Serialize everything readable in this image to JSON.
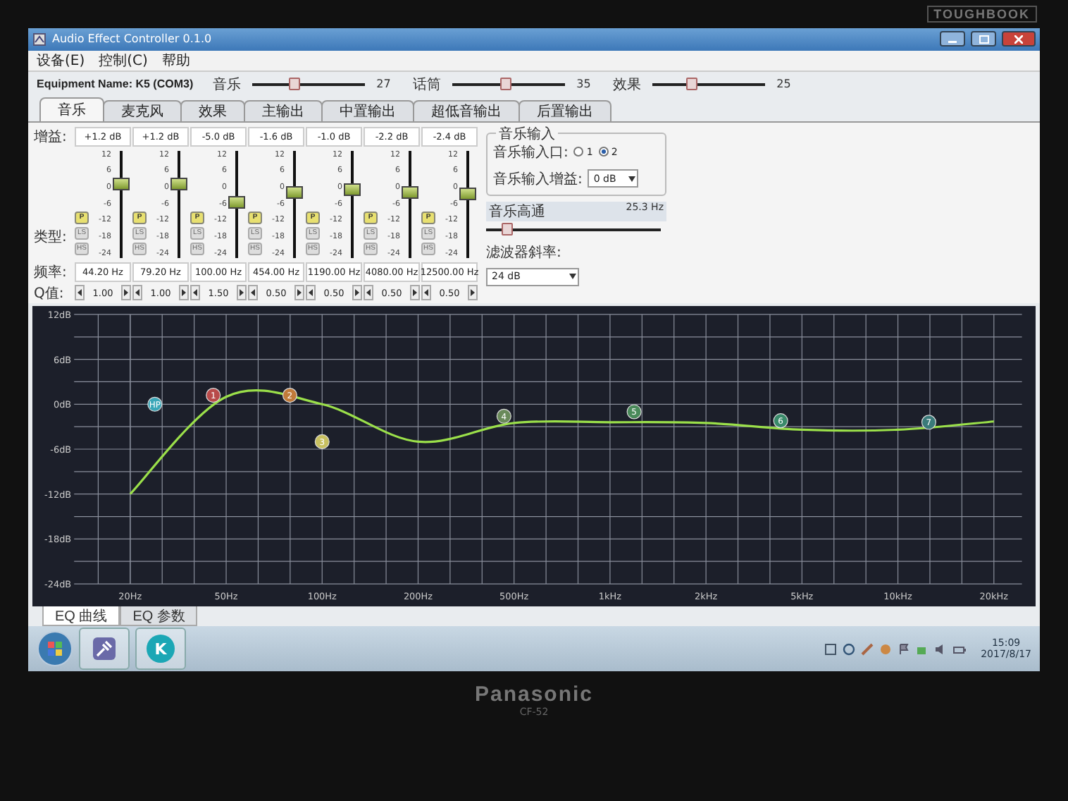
{
  "bezel": {
    "badge": "TOUGHBOOK",
    "brand": "Panasonic",
    "model": "CF-52"
  },
  "window": {
    "title": "Audio Effect Controller 0.1.0"
  },
  "menu": [
    {
      "label": "设备(E)"
    },
    {
      "label": "控制(C)"
    },
    {
      "label": "帮助"
    }
  ],
  "equipment": {
    "label": "Equipment Name: K5 (COM3)"
  },
  "volumes": [
    {
      "label": "音乐",
      "value": "27",
      "level": 0.37
    },
    {
      "label": "话筒",
      "value": "35",
      "level": 0.47
    },
    {
      "label": "效果",
      "value": "25",
      "level": 0.35
    }
  ],
  "tabs": [
    {
      "label": "音乐",
      "selected": true
    },
    {
      "label": "麦克风",
      "selected": false
    },
    {
      "label": "效果",
      "selected": false
    },
    {
      "label": "主输出",
      "selected": false
    },
    {
      "label": "中置输出",
      "selected": false
    },
    {
      "label": "超低音输出",
      "selected": false
    },
    {
      "label": "后置输出",
      "selected": false
    }
  ],
  "eq": {
    "row_labels": {
      "gain": "增益:",
      "type": "类型:",
      "freq": "频率:",
      "q": "Q值:"
    },
    "bands": [
      {
        "gain": "+1.2 dB",
        "level": 0.7,
        "scale": [
          "12",
          "6",
          "0",
          "-6",
          "-12",
          "-18",
          "-24"
        ],
        "types": [
          {
            "label": "P",
            "selected": true
          },
          {
            "label": "LS",
            "selected": false
          },
          {
            "label": "HS",
            "selected": false
          }
        ],
        "freq": "44.20 Hz",
        "q": "1.00"
      },
      {
        "gain": "+1.2 dB",
        "level": 0.7,
        "scale": [
          "12",
          "6",
          "0",
          "-6",
          "-12",
          "-18",
          "-24"
        ],
        "types": [
          {
            "label": "P",
            "selected": true
          },
          {
            "label": "LS",
            "selected": false
          },
          {
            "label": "HS",
            "selected": false
          }
        ],
        "freq": "79.20 Hz",
        "q": "1.00"
      },
      {
        "gain": "-5.0 dB",
        "level": 0.53,
        "scale": [
          "12",
          "6",
          "0",
          "-6",
          "-12",
          "-18",
          "-24"
        ],
        "types": [
          {
            "label": "P",
            "selected": true
          },
          {
            "label": "LS",
            "selected": false
          },
          {
            "label": "HS",
            "selected": false
          }
        ],
        "freq": "100.00 Hz",
        "q": "1.50"
      },
      {
        "gain": "-1.6 dB",
        "level": 0.62,
        "scale": [
          "12",
          "6",
          "0",
          "-6",
          "-12",
          "-18",
          "-24"
        ],
        "types": [
          {
            "label": "P",
            "selected": true
          },
          {
            "label": "LS",
            "selected": false
          },
          {
            "label": "HS",
            "selected": false
          }
        ],
        "freq": "454.00 Hz",
        "q": "0.50"
      },
      {
        "gain": "-1.0 dB",
        "level": 0.64,
        "scale": [
          "12",
          "6",
          "0",
          "-6",
          "-12",
          "-18",
          "-24"
        ],
        "types": [
          {
            "label": "P",
            "selected": true
          },
          {
            "label": "LS",
            "selected": false
          },
          {
            "label": "HS",
            "selected": false
          }
        ],
        "freq": "1190.00 Hz",
        "q": "0.50"
      },
      {
        "gain": "-2.2 dB",
        "level": 0.61,
        "scale": [
          "12",
          "6",
          "0",
          "-6",
          "-12",
          "-18",
          "-24"
        ],
        "types": [
          {
            "label": "P",
            "selected": true
          },
          {
            "label": "LS",
            "selected": false
          },
          {
            "label": "HS",
            "selected": false
          }
        ],
        "freq": "4080.00 Hz",
        "q": "0.50"
      },
      {
        "gain": "-2.4 dB",
        "level": 0.6,
        "scale": [
          "12",
          "6",
          "0",
          "-6",
          "-12",
          "-18",
          "-24"
        ],
        "types": [
          {
            "label": "P",
            "selected": true
          },
          {
            "label": "LS",
            "selected": false
          },
          {
            "label": "HS",
            "selected": false
          }
        ],
        "freq": "12500.00 Hz",
        "q": "0.50"
      }
    ],
    "chart_data": {
      "type": "line",
      "categories": [
        "20Hz",
        "50Hz",
        "100Hz",
        "200Hz",
        "500Hz",
        "1kHz",
        "2kHz",
        "5kHz",
        "10kHz",
        "20kHz"
      ],
      "series": [
        {
          "color": "#9be04a",
          "values": [
            -12,
            1,
            0,
            -5,
            -2.5,
            -2.4,
            -2.5,
            -3.4,
            -3.4,
            -2.3
          ]
        }
      ],
      "ylim": [
        -24,
        12
      ],
      "grid": true,
      "yticks": [
        {
          "value": 12,
          "label": "12dB"
        },
        {
          "value": 6,
          "label": "6dB"
        },
        {
          "value": 0,
          "label": "0dB"
        },
        {
          "value": -6,
          "label": "-6dB"
        },
        {
          "value": -12,
          "label": "-12dB"
        },
        {
          "value": -18,
          "label": "-18dB"
        },
        {
          "value": -24,
          "label": "-24dB"
        }
      ],
      "annotations": [
        "HP",
        "1",
        "2",
        "3",
        "4",
        "5",
        "6",
        "7"
      ]
    },
    "marker_colors": [
      {
        "color": "#3aa6b8"
      },
      {
        "color": "#b84a4a"
      },
      {
        "color": "#c07a3a"
      },
      {
        "color": "#c8c060"
      },
      {
        "color": "#6a8a5a"
      },
      {
        "color": "#4a8a5a"
      },
      {
        "color": "#3a8a6a"
      },
      {
        "color": "#3a7a7a"
      }
    ]
  },
  "music_input": {
    "title": "音乐输入",
    "port_label": "音乐输入口:",
    "ports": [
      {
        "label": "1",
        "selected": false
      },
      {
        "label": "2",
        "selected": true
      }
    ],
    "gain_label": "音乐输入增益:",
    "gain_value": "0 dB"
  },
  "highpass": {
    "label": "音乐高通",
    "value": "25.3 Hz",
    "level": 0.12
  },
  "slope": {
    "label": "滤波器斜率:",
    "value": "24 dB"
  },
  "bottom_tabs": [
    {
      "label": "EQ 曲线",
      "selected": true
    },
    {
      "label": "EQ 参数",
      "selected": false
    }
  ],
  "taskbar": {
    "app_letter": "K",
    "time": "15:09",
    "date": "2017/8/17"
  }
}
